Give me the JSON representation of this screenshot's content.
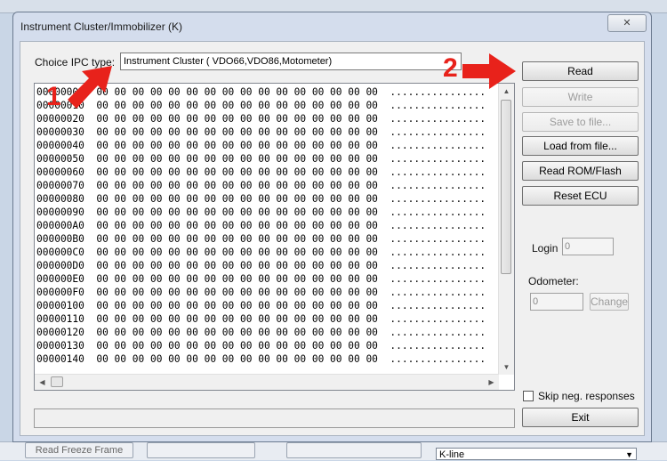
{
  "window": {
    "title": "Instrument Cluster/Immobilizer (K)",
    "close_glyph": "✕"
  },
  "ipc": {
    "label": "Choice IPC type:",
    "value": "Instrument Cluster (  VDO66,VDO86,Motometer)"
  },
  "hex": {
    "addresses": [
      "00000000",
      "00000010",
      "00000020",
      "00000030",
      "00000040",
      "00000050",
      "00000060",
      "00000070",
      "00000080",
      "00000090",
      "000000A0",
      "000000B0",
      "000000C0",
      "000000D0",
      "000000E0",
      "000000F0",
      "00000100",
      "00000110",
      "00000120",
      "00000130",
      "00000140"
    ],
    "byte_value": "00",
    "bytes_per_row": 16,
    "ascii_value": "................"
  },
  "buttons": {
    "read": "Read",
    "write": "Write",
    "save": "Save to file...",
    "load": "Load from file...",
    "read_rom": "Read ROM/Flash",
    "reset_ecu": "Reset ECU",
    "change": "Change",
    "exit": "Exit"
  },
  "login": {
    "label": "Login",
    "value": "0"
  },
  "odometer": {
    "label": "Odometer:",
    "value": "0"
  },
  "skip_neg": {
    "label": "Skip neg. responses",
    "checked": false
  },
  "annotations": {
    "step1": "1",
    "step2": "2",
    "color": "#e8221b"
  },
  "background": {
    "read_freeze_frame": "Read Freeze Frame",
    "kline_select": "K-line"
  }
}
